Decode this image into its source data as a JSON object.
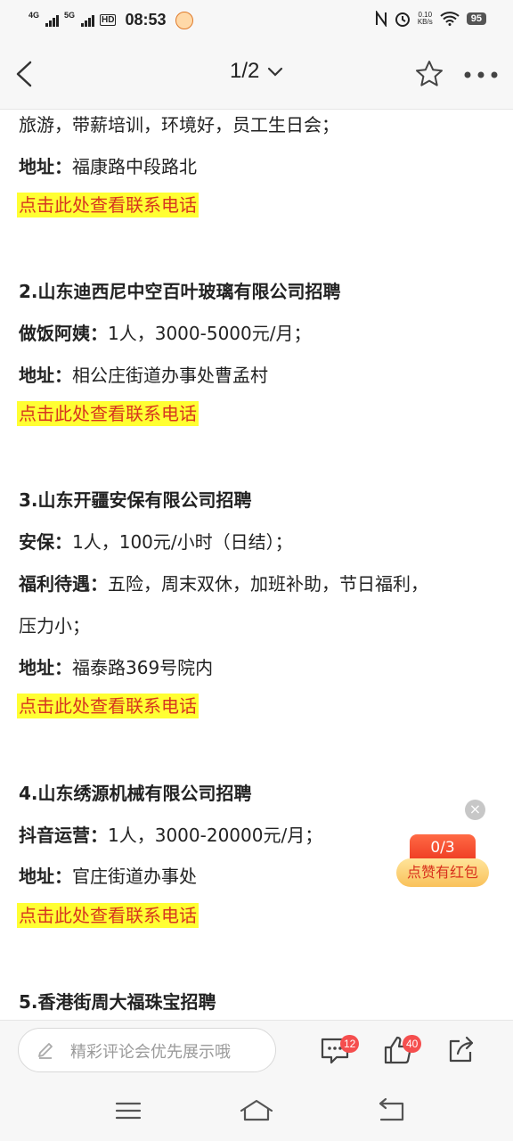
{
  "status_bar": {
    "net1": "4G",
    "net2": "5G",
    "hd": "HD",
    "time": "08:53",
    "speed_value": "0.10",
    "speed_unit": "KB/s",
    "battery": "95"
  },
  "header": {
    "page_indicator": "1/2"
  },
  "article": {
    "lines": [
      {
        "type": "text",
        "text": "旅游，带薪培训，环境好，员工生日会；"
      },
      {
        "type": "kv",
        "label": "地址：",
        "value": "福康路中段路北"
      },
      {
        "type": "link",
        "text": "点击此处查看联系电话"
      },
      {
        "type": "heading",
        "text": "2.山东迪西尼中空百叶玻璃有限公司招聘"
      },
      {
        "type": "kv",
        "label": "做饭阿姨：",
        "value": "1人，3000-5000元/月；"
      },
      {
        "type": "kv",
        "label": "地址：",
        "value": "相公庄街道办事处曹孟村"
      },
      {
        "type": "link",
        "text": "点击此处查看联系电话"
      },
      {
        "type": "heading",
        "text": "3.山东开疆安保有限公司招聘"
      },
      {
        "type": "kv",
        "label": "安保：",
        "value": "1人，100元/小时（日结）；"
      },
      {
        "type": "kv",
        "label": "福利待遇：",
        "value": "五险，周末双休，加班补助，节日福利，"
      },
      {
        "type": "text",
        "text": "压力小；"
      },
      {
        "type": "kv",
        "label": "地址：",
        "value": "福泰路369号院内"
      },
      {
        "type": "link",
        "text": "点击此处查看联系电话"
      },
      {
        "type": "heading",
        "text": "4.山东绣源机械有限公司招聘"
      },
      {
        "type": "kv",
        "label": "抖音运营：",
        "value": "1人，3000-20000元/月；"
      },
      {
        "type": "kv",
        "label": "地址：",
        "value": "官庄街道办事处"
      },
      {
        "type": "link",
        "text": "点击此处查看联系电话"
      },
      {
        "type": "heading",
        "text": "5.香港街周大福珠宝招聘"
      }
    ]
  },
  "float_widget": {
    "close": "×",
    "count": "0/3",
    "label": "点赞有红包"
  },
  "comment_bar": {
    "placeholder": "精彩评论会优先展示哦",
    "comment_count": "12",
    "like_count": "40"
  }
}
